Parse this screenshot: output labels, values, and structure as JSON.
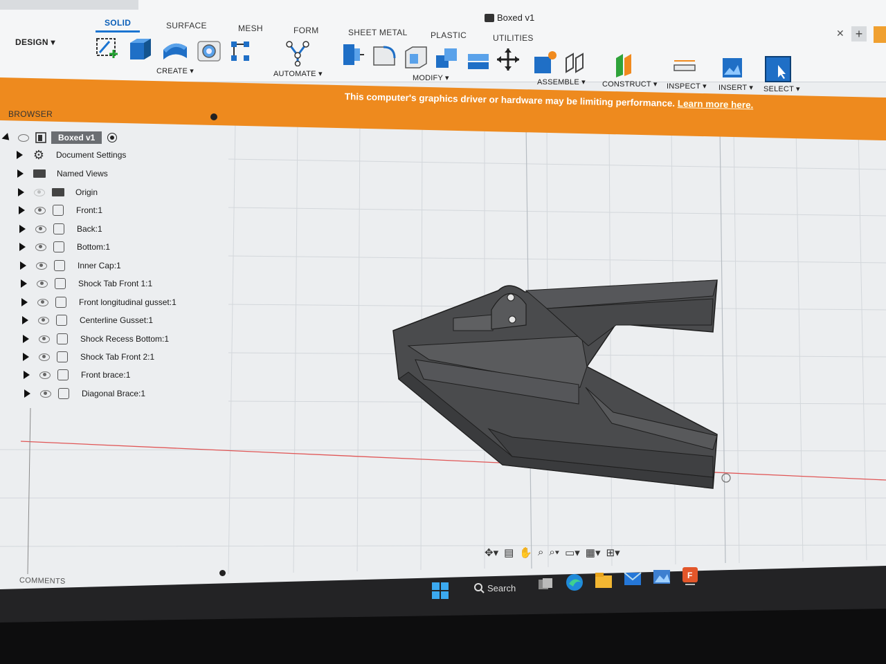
{
  "window": {
    "doc_title": "Boxed v1"
  },
  "workspace": {
    "label": "DESIGN"
  },
  "tabs": [
    {
      "label": "SOLID"
    },
    {
      "label": "SURFACE"
    },
    {
      "label": "MESH"
    },
    {
      "label": "FORM"
    },
    {
      "label": "SHEET METAL"
    },
    {
      "label": "PLASTIC"
    },
    {
      "label": "UTILITIES"
    }
  ],
  "groups": {
    "create": "CREATE",
    "automate": "AUTOMATE",
    "modify": "MODIFY",
    "assemble": "ASSEMBLE",
    "construct": "CONSTRUCT",
    "inspect": "INSPECT",
    "insert": "INSERT",
    "select": "SELECT"
  },
  "banner": {
    "message": "This computer's graphics driver or hardware may be limiting performance.",
    "link": "Learn more here."
  },
  "browser": {
    "title": "BROWSER",
    "root": "Boxed v1",
    "items": [
      {
        "label": "Document Settings",
        "kind": "settings"
      },
      {
        "label": "Named Views",
        "kind": "folder"
      },
      {
        "label": "Origin",
        "kind": "folder"
      },
      {
        "label": "Front:1",
        "kind": "body"
      },
      {
        "label": "Back:1",
        "kind": "body"
      },
      {
        "label": "Bottom:1",
        "kind": "body"
      },
      {
        "label": "Inner Cap:1",
        "kind": "body"
      },
      {
        "label": "Shock Tab Front 1:1",
        "kind": "body"
      },
      {
        "label": "Front longitudinal gusset:1",
        "kind": "body"
      },
      {
        "label": "Centerline Gusset:1",
        "kind": "body"
      },
      {
        "label": "Shock Recess Bottom:1",
        "kind": "body"
      },
      {
        "label": "Shock Tab Front 2:1",
        "kind": "body"
      },
      {
        "label": "Front brace:1",
        "kind": "body"
      },
      {
        "label": "Diagonal Brace:1",
        "kind": "body"
      }
    ]
  },
  "comments": {
    "title": "COMMENTS"
  },
  "taskbar": {
    "search_label": "Search"
  },
  "colors": {
    "accent": "#1a74d1",
    "banner": "#ee8a1e",
    "model": "#4a4b4d",
    "grid": "#cfd3d8"
  }
}
